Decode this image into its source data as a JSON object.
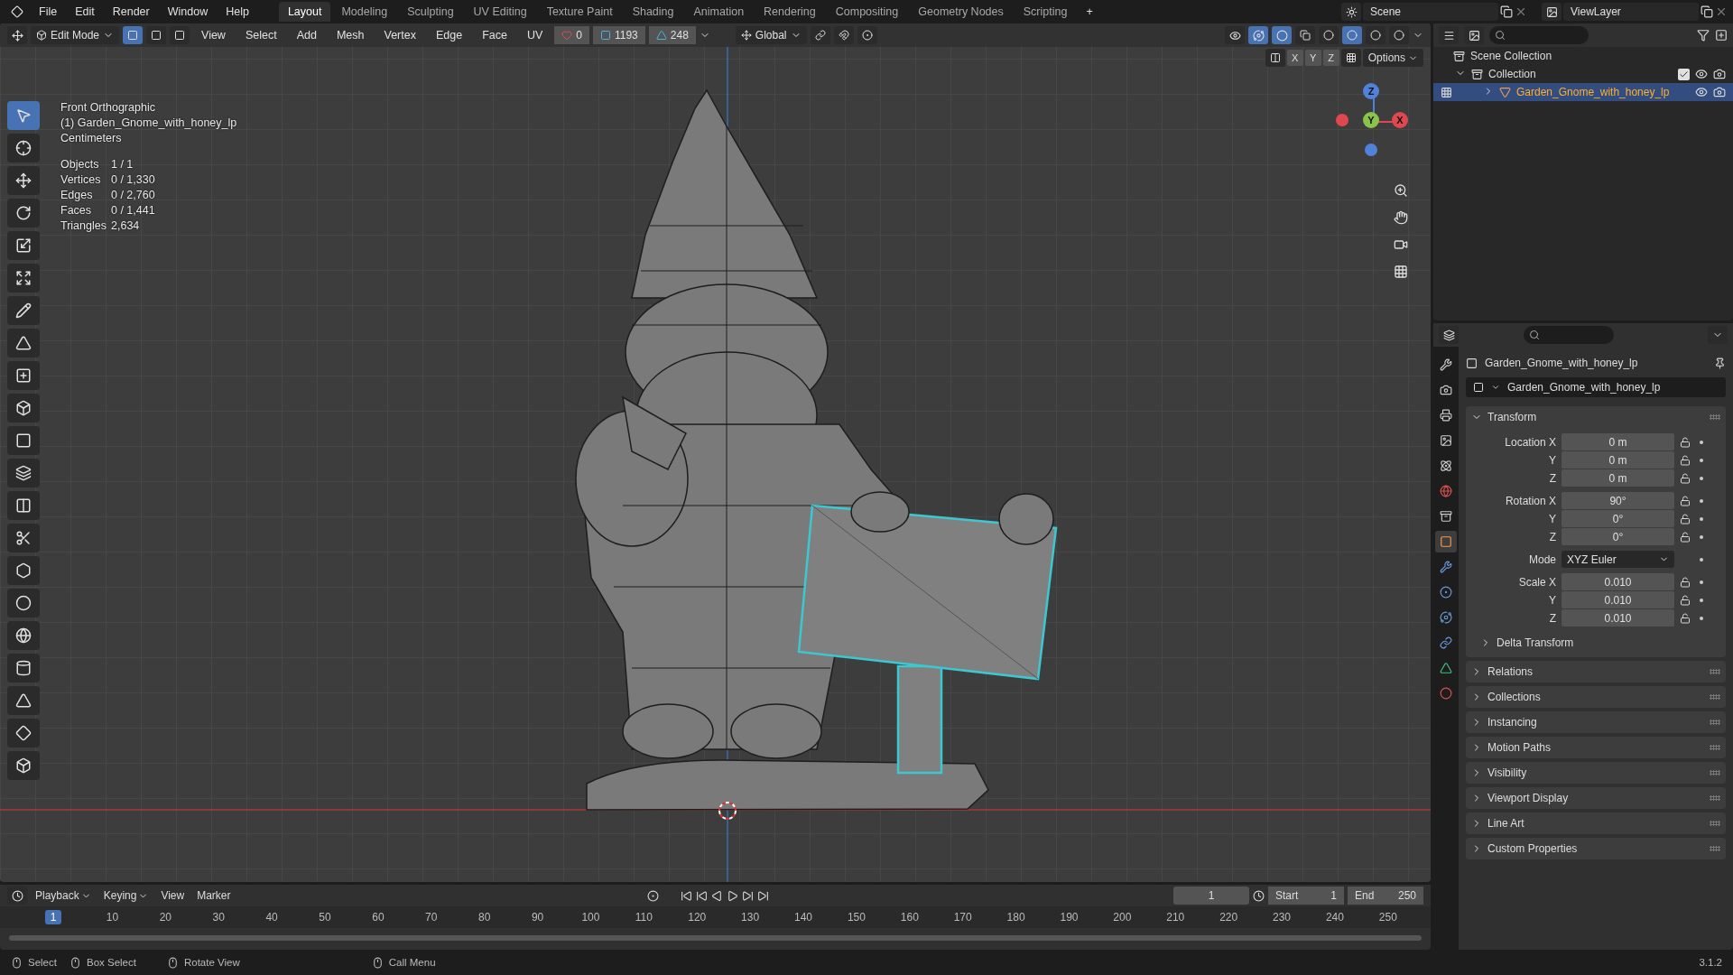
{
  "topbar": {
    "menus": [
      "File",
      "Edit",
      "Render",
      "Window",
      "Help"
    ],
    "workspaces": [
      {
        "label": "Layout",
        "selected": true
      },
      {
        "label": "Modeling",
        "selected": false
      },
      {
        "label": "Sculpting",
        "selected": false
      },
      {
        "label": "UV Editing",
        "selected": false
      },
      {
        "label": "Texture Paint",
        "selected": false
      },
      {
        "label": "Shading",
        "selected": false
      },
      {
        "label": "Animation",
        "selected": false
      },
      {
        "label": "Rendering",
        "selected": false
      },
      {
        "label": "Compositing",
        "selected": false
      },
      {
        "label": "Geometry Nodes",
        "selected": false
      },
      {
        "label": "Scripting",
        "selected": false
      }
    ],
    "add_tab": "+",
    "scene": "Scene",
    "view_layer": "ViewLayer"
  },
  "viewport_header": {
    "mode": "Edit Mode",
    "select_modes": [
      {
        "selected": true
      },
      {
        "selected": false
      },
      {
        "selected": false
      }
    ],
    "menus": [
      "View",
      "Select",
      "Add",
      "Mesh",
      "Vertex",
      "Edge",
      "Face",
      "UV"
    ],
    "counters": [
      "0",
      "1193",
      "248"
    ],
    "orientation": "Global",
    "axes": [
      "X",
      "Y",
      "Z"
    ],
    "options": "Options",
    "shading": [
      {
        "selected": false
      },
      {
        "selected": true
      },
      {
        "selected": false
      },
      {
        "selected": false
      }
    ]
  },
  "viewport": {
    "view_name": "Front Orthographic",
    "object_label": "(1) Garden_Gnome_with_honey_lp",
    "units": "Centimeters",
    "stats": [
      {
        "label": "Objects",
        "value": "1 / 1"
      },
      {
        "label": "Vertices",
        "value": "0 / 1,330"
      },
      {
        "label": "Edges",
        "value": "0 / 2,760"
      },
      {
        "label": "Faces",
        "value": "0 / 1,441"
      },
      {
        "label": "Triangles",
        "value": "2,634"
      }
    ],
    "gizmo_axes": [
      {
        "kind": "z",
        "label": "Z"
      },
      {
        "kind": "y",
        "label": "Y"
      },
      {
        "kind": "x",
        "label": "X"
      }
    ]
  },
  "tools": [
    {
      "selected": true
    },
    {
      "selected": false
    },
    {
      "selected": false
    },
    {
      "selected": false
    },
    {
      "selected": false
    },
    {
      "selected": false
    },
    {
      "selected": false
    },
    {
      "selected": false
    },
    {
      "selected": false
    },
    {
      "selected": false
    },
    {
      "selected": false
    },
    {
      "selected": false
    },
    {
      "selected": false
    },
    {
      "selected": false
    },
    {
      "selected": false
    },
    {
      "selected": false
    },
    {
      "selected": false
    },
    {
      "selected": false
    },
    {
      "selected": false
    },
    {
      "selected": false
    },
    {
      "selected": false
    }
  ],
  "outliner": {
    "root": "Scene Collection",
    "items": [
      {
        "label": "Collection",
        "expanded": true,
        "checked": true,
        "selected": false,
        "children": [
          {
            "label": "Garden_Gnome_with_honey_lp",
            "expanded": false,
            "selected": true
          }
        ]
      }
    ]
  },
  "properties": {
    "tabs": [
      {
        "selected": false
      },
      {
        "selected": false
      },
      {
        "selected": false
      },
      {
        "selected": false
      },
      {
        "selected": false
      },
      {
        "selected": false
      },
      {
        "selected": false
      },
      {
        "selected": true
      },
      {
        "selected": false
      },
      {
        "selected": false
      },
      {
        "selected": false
      },
      {
        "selected": false
      },
      {
        "selected": false
      },
      {
        "selected": false
      }
    ],
    "title": "Garden_Gnome_with_honey_lp",
    "object_name": "Garden_Gnome_with_honey_lp",
    "transform": {
      "label": "Transform",
      "expanded": true,
      "groups": [
        [
          {
            "label": "Location X",
            "value": "0 m",
            "kind": "number"
          },
          {
            "label": "Y",
            "value": "0 m",
            "kind": "number"
          },
          {
            "label": "Z",
            "value": "0 m",
            "kind": "number"
          }
        ],
        [
          {
            "label": "Rotation X",
            "value": "90°",
            "kind": "number"
          },
          {
            "label": "Y",
            "value": "0°",
            "kind": "number"
          },
          {
            "label": "Z",
            "value": "0°",
            "kind": "number"
          }
        ],
        [
          {
            "label": "Mode",
            "value": "XYZ Euler",
            "kind": "dropdown"
          }
        ],
        [
          {
            "label": "Scale X",
            "value": "0.010",
            "kind": "number"
          },
          {
            "label": "Y",
            "value": "0.010",
            "kind": "number"
          },
          {
            "label": "Z",
            "value": "0.010",
            "kind": "number"
          }
        ]
      ],
      "delta": {
        "label": "Delta Transform",
        "expanded": false
      }
    },
    "panels": [
      {
        "label": "Relations",
        "expanded": false
      },
      {
        "label": "Collections",
        "expanded": false
      },
      {
        "label": "Instancing",
        "expanded": false
      },
      {
        "label": "Motion Paths",
        "expanded": false
      },
      {
        "label": "Visibility",
        "expanded": false
      },
      {
        "label": "Viewport Display",
        "expanded": false
      },
      {
        "label": "Line Art",
        "expanded": false
      },
      {
        "label": "Custom Properties",
        "expanded": false
      }
    ]
  },
  "timeline": {
    "menus": [
      "Playback",
      "Keying",
      "View",
      "Marker"
    ],
    "current_frame": "1",
    "start_label": "Start",
    "start": "1",
    "end_label": "End",
    "end": "250",
    "ruler": [
      {
        "label": "1",
        "selected": true
      },
      {
        "label": "10",
        "selected": false
      },
      {
        "label": "20",
        "selected": false
      },
      {
        "label": "30",
        "selected": false
      },
      {
        "label": "40",
        "selected": false
      },
      {
        "label": "50",
        "selected": false
      },
      {
        "label": "60",
        "selected": false
      },
      {
        "label": "70",
        "selected": false
      },
      {
        "label": "80",
        "selected": false
      },
      {
        "label": "90",
        "selected": false
      },
      {
        "label": "100",
        "selected": false
      },
      {
        "label": "110",
        "selected": false
      },
      {
        "label": "120",
        "selected": false
      },
      {
        "label": "130",
        "selected": false
      },
      {
        "label": "140",
        "selected": false
      },
      {
        "label": "150",
        "selected": false
      },
      {
        "label": "160",
        "selected": false
      },
      {
        "label": "170",
        "selected": false
      },
      {
        "label": "180",
        "selected": false
      },
      {
        "label": "190",
        "selected": false
      },
      {
        "label": "200",
        "selected": false
      },
      {
        "label": "210",
        "selected": false
      },
      {
        "label": "220",
        "selected": false
      },
      {
        "label": "230",
        "selected": false
      },
      {
        "label": "240",
        "selected": false
      },
      {
        "label": "250",
        "selected": false
      }
    ]
  },
  "status_bar": {
    "hints": [
      "Select",
      "Box Select",
      "Rotate View",
      "Call Menu"
    ],
    "version": "3.1.2"
  }
}
